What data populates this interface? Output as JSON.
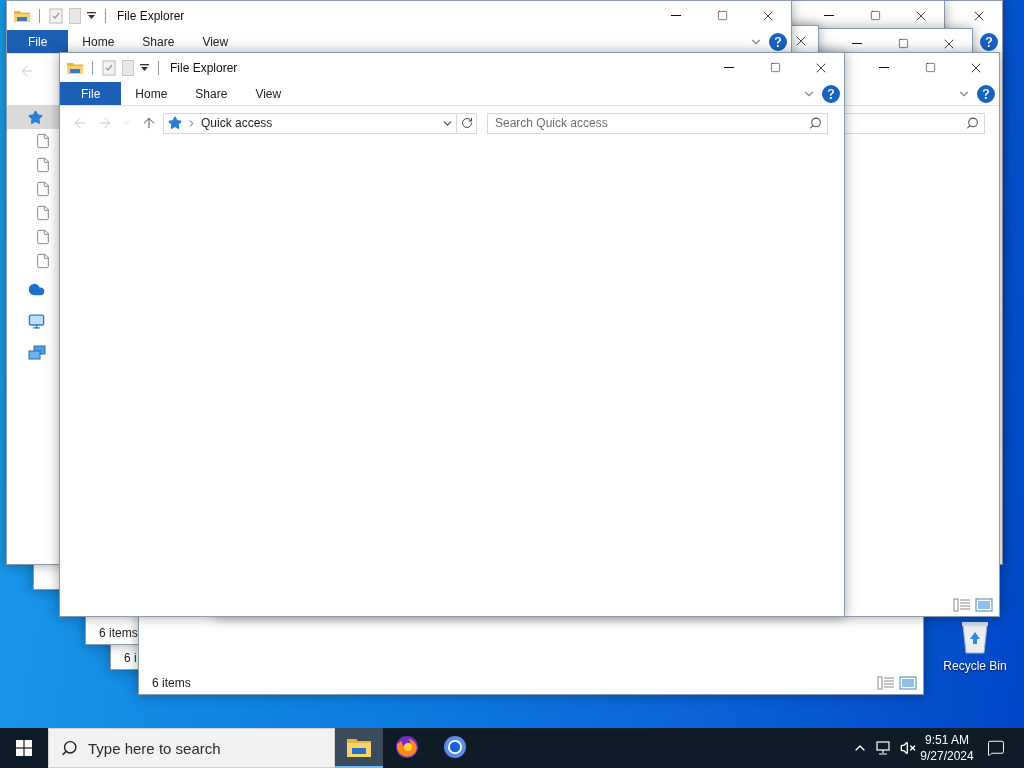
{
  "desktop": {
    "icons": [
      {
        "label": "Recycle Bin"
      }
    ]
  },
  "windows": [
    {
      "caption_buttons": [
        {
          "kind": "close"
        }
      ]
    },
    {
      "status": {
        "text": "6 items"
      }
    },
    {
      "status": {
        "text": "6 i"
      }
    },
    {
      "status": {
        "text": "6 items",
        "view_buttons": true
      }
    },
    {
      "caption_buttons": [
        {
          "kind": "close"
        }
      ],
      "ribbon_icons": [
        {
          "kind": "help"
        }
      ]
    },
    {
      "caption_buttons": [
        {
          "kind": "minimize"
        },
        {
          "kind": "maximize"
        },
        {
          "kind": "close"
        }
      ]
    },
    {
      "caption_buttons": [
        {
          "kind": "minimize"
        },
        {
          "kind": "maximize"
        },
        {
          "kind": "close"
        }
      ]
    },
    {
      "caption_buttons": [
        {
          "kind": "minimize"
        },
        {
          "kind": "maximize"
        },
        {
          "kind": "close"
        }
      ],
      "ribbon_icons": [
        {
          "kind": "chevron"
        },
        {
          "kind": "help"
        }
      ],
      "search": {
        "visible": true
      },
      "status": {
        "view_buttons": true
      }
    },
    {
      "title": "File Explorer",
      "caption_buttons": [
        {
          "kind": "minimize"
        },
        {
          "kind": "maximize"
        },
        {
          "kind": "close"
        }
      ],
      "tabs": [
        {
          "label": "File",
          "selected": true
        },
        {
          "label": "Home",
          "selected": false
        },
        {
          "label": "Share",
          "selected": false
        },
        {
          "label": "View",
          "selected": false
        }
      ],
      "ribbon_icons": [
        {
          "kind": "chevron"
        },
        {
          "kind": "help"
        }
      ],
      "nav_buttons": [
        {
          "kind": "back",
          "disabled": true
        }
      ],
      "nav_pane": [
        {
          "kind": "quick-access",
          "selected": true
        },
        {
          "kind": "document",
          "selected": false
        },
        {
          "kind": "document",
          "selected": false
        },
        {
          "kind": "document",
          "selected": false
        },
        {
          "kind": "document",
          "selected": false
        },
        {
          "kind": "document",
          "selected": false
        },
        {
          "kind": "document",
          "selected": false
        },
        {
          "kind": "cloud",
          "selected": false
        },
        {
          "kind": "pc",
          "selected": false
        },
        {
          "kind": "network",
          "selected": false
        }
      ]
    },
    {
      "title": "File Explorer",
      "caption_buttons": [
        {
          "kind": "minimize"
        },
        {
          "kind": "maximize"
        },
        {
          "kind": "close"
        }
      ],
      "tabs": [
        {
          "label": "File",
          "selected": true
        },
        {
          "label": "Home",
          "selected": false
        },
        {
          "label": "Share",
          "selected": false
        },
        {
          "label": "View",
          "selected": false
        }
      ],
      "ribbon_icons": [
        {
          "kind": "chevron"
        },
        {
          "kind": "help"
        }
      ],
      "nav_buttons": [
        {
          "kind": "back",
          "disabled": true
        },
        {
          "kind": "forward",
          "disabled": true
        },
        {
          "kind": "recent",
          "disabled": true
        },
        {
          "kind": "up",
          "disabled": false
        }
      ],
      "address": {
        "location": "Quick access"
      },
      "search": {
        "visible": true,
        "placeholder": "Search Quick access"
      }
    }
  ],
  "taskbar": {
    "search": {
      "placeholder": "Type here to search"
    },
    "apps": [
      {
        "kind": "file-explorer",
        "active": true
      },
      {
        "kind": "firefox",
        "active": false
      },
      {
        "kind": "chromium",
        "active": false
      }
    ],
    "tray": {
      "time": "9:51 AM",
      "date": "9/27/2024"
    }
  }
}
